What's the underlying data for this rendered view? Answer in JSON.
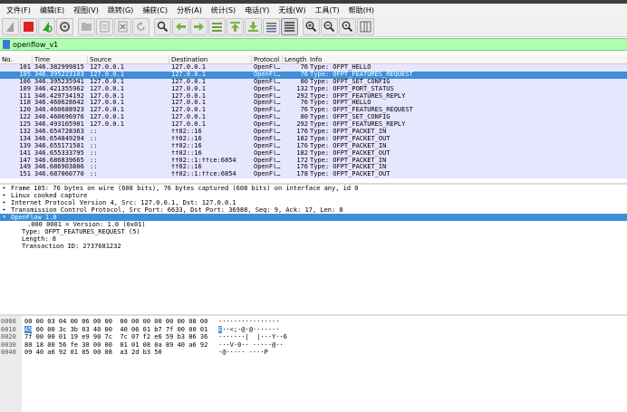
{
  "menu": [
    "文件(F)",
    "编辑(E)",
    "视图(V)",
    "跳转(G)",
    "捕获(C)",
    "分析(A)",
    "统计(S)",
    "电话(Y)",
    "无线(W)",
    "工具(T)",
    "帮助(H)"
  ],
  "toolbar_icons": [
    "shark-fin-start-icon",
    "stop-capture-icon",
    "restart-capture-icon",
    "capture-options-icon",
    "open-file-icon",
    "save-file-icon",
    "close-file-icon",
    "reload-file-icon",
    "find-packet-icon",
    "go-back-icon",
    "go-forward-icon",
    "go-to-packet-icon",
    "go-first-icon",
    "go-last-icon",
    "auto-scroll-icon",
    "colorize-icon",
    "zoom-in-icon",
    "zoom-out-icon",
    "zoom-normal-icon",
    "resize-columns-icon"
  ],
  "filter": {
    "value": "openflow_v1"
  },
  "columns": [
    "No.",
    "Time",
    "Source",
    "Destination",
    "Protocol",
    "Length",
    "Info"
  ],
  "packets": [
    {
      "no": "101",
      "time": "346.382999815",
      "src": "127.0.0.1",
      "dst": "127.0.0.1",
      "proto": "OpenFl…",
      "len": "76",
      "info": "Type: OFPT_HELLO"
    },
    {
      "no": "105",
      "time": "346.395223103",
      "src": "127.0.0.1",
      "dst": "127.0.0.1",
      "proto": "OpenFl…",
      "len": "76",
      "info": "Type: OFPT_FEATURES_REQUEST",
      "selected": true
    },
    {
      "no": "106",
      "time": "346.395235941",
      "src": "127.0.0.1",
      "dst": "127.0.0.1",
      "proto": "OpenFl…",
      "len": "80",
      "info": "Type: OFPT_SET_CONFIG"
    },
    {
      "no": "109",
      "time": "346.421355962",
      "src": "127.0.0.1",
      "dst": "127.0.0.1",
      "proto": "OpenFl…",
      "len": "132",
      "info": "Type: OFPT_PORT_STATUS"
    },
    {
      "no": "111",
      "time": "346.429734192",
      "src": "127.0.0.1",
      "dst": "127.0.0.1",
      "proto": "OpenFl…",
      "len": "292",
      "info": "Type: OFPT_FEATURES_REPLY"
    },
    {
      "no": "118",
      "time": "346.460628642",
      "src": "127.0.0.1",
      "dst": "127.0.0.1",
      "proto": "OpenFl…",
      "len": "76",
      "info": "Type: OFPT_HELLO"
    },
    {
      "no": "120",
      "time": "346.460688923",
      "src": "127.0.0.1",
      "dst": "127.0.0.1",
      "proto": "OpenFl…",
      "len": "76",
      "info": "Type: OFPT_FEATURES_REQUEST"
    },
    {
      "no": "122",
      "time": "346.460696976",
      "src": "127.0.0.1",
      "dst": "127.0.0.1",
      "proto": "OpenFl…",
      "len": "80",
      "info": "Type: OFPT_SET_CONFIG"
    },
    {
      "no": "125",
      "time": "346.493165901",
      "src": "127.0.0.1",
      "dst": "127.0.0.1",
      "proto": "OpenFl…",
      "len": "292",
      "info": "Type: OFPT_FEATURES_REPLY"
    },
    {
      "no": "132",
      "time": "346.654728363",
      "src": "::",
      "dst": "ff02::16",
      "proto": "OpenFl…",
      "len": "176",
      "info": "Type: OFPT_PACKET_IN"
    },
    {
      "no": "134",
      "time": "346.654849294",
      "src": "::",
      "dst": "ff02::16",
      "proto": "OpenFl…",
      "len": "182",
      "info": "Type: OFPT_PACKET_OUT"
    },
    {
      "no": "139",
      "time": "346.655171501",
      "src": "::",
      "dst": "ff02::16",
      "proto": "OpenFl…",
      "len": "176",
      "info": "Type: OFPT_PACKET_IN"
    },
    {
      "no": "141",
      "time": "346.655333795",
      "src": "::",
      "dst": "ff02::16",
      "proto": "OpenFl…",
      "len": "182",
      "info": "Type: OFPT_PACKET_OUT"
    },
    {
      "no": "147",
      "time": "346.686839665",
      "src": "::",
      "dst": "ff02::1:ffce:6854",
      "proto": "OpenFl…",
      "len": "172",
      "info": "Type: OFPT_PACKET_IN"
    },
    {
      "no": "149",
      "time": "346.686903806",
      "src": "::",
      "dst": "ff02::16",
      "proto": "OpenFl…",
      "len": "176",
      "info": "Type: OFPT_PACKET_IN"
    },
    {
      "no": "151",
      "time": "346.687060770",
      "src": "::",
      "dst": "ff02::1:ffce:6854",
      "proto": "OpenFl…",
      "len": "178",
      "info": "Type: OFPT_PACKET_OUT"
    }
  ],
  "details": [
    {
      "text": "Frame 105: 76 bytes on wire (608 bits), 76 bytes captured (608 bits) on interface any, id 0",
      "level": 0,
      "arrow": "▸"
    },
    {
      "text": "Linux cooked capture",
      "level": 0,
      "arrow": "▸"
    },
    {
      "text": "Internet Protocol Version 4, Src: 127.0.0.1, Dst: 127.0.0.1",
      "level": 0,
      "arrow": "▸"
    },
    {
      "text": "Transmission Control Protocol, Src Port: 6633, Dst Port: 36988, Seq: 9, Ack: 17, Len: 8",
      "level": 0,
      "arrow": "▸"
    },
    {
      "text": "OpenFlow 1.0",
      "level": 0,
      "arrow": "▾",
      "selected": true
    },
    {
      "text": ".000 0001 = Version: 1.0 (0x01)",
      "level": 2
    },
    {
      "text": "Type: OFPT_FEATURES_REQUEST (5)",
      "level": 1
    },
    {
      "text": "Length: 8",
      "level": 1
    },
    {
      "text": "Transaction ID: 2737681232",
      "level": 1
    }
  ],
  "bytes": [
    {
      "offset": "0000",
      "hex": "00 00 03 04 00 06 00 00  00 00 00 00 00 00 08 00",
      "ascii": "················"
    },
    {
      "offset": "0010",
      "hex_hl": "45",
      "hex": " 00 00 3c 3b 03 40 00  40 06 01 b7 7f 00 00 01",
      "ascii_hl": "E",
      "ascii": "··<;·@·@·······"
    },
    {
      "offset": "0020",
      "hex": "7f 00 00 01 19 e9 90 7c  7c 07 f2 e6 59 b3 86 36",
      "ascii": "·······|  |···Y··6"
    },
    {
      "offset": "0030",
      "hex": "80 18 00 56 fe 30 00 00  01 01 08 0a 89 40 a6 92",
      "ascii": "···V·0·· ·····@··"
    },
    {
      "offset": "0040",
      "hex": "09 40 a6 92 01 05 00 08  a3 2d b3 50",
      "ascii": "·@····· ··-·P"
    }
  ]
}
